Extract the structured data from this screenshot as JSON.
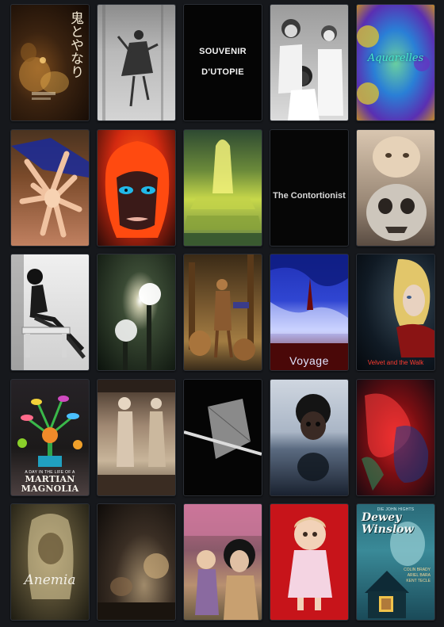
{
  "posters": [
    {
      "id": "oni",
      "title": "鬼とやなり"
    },
    {
      "id": "bw-dancer",
      "title": ""
    },
    {
      "id": "souvenir",
      "title_line1": "SOUVENIR",
      "title_line2": "D'UTOPIE"
    },
    {
      "id": "girls",
      "title": ""
    },
    {
      "id": "aquarelles",
      "title": "Aquarelles"
    },
    {
      "id": "dolls-limbs",
      "title": ""
    },
    {
      "id": "redhair",
      "title": ""
    },
    {
      "id": "fountain",
      "title": ""
    },
    {
      "id": "contortionist",
      "title": "The Contortionist"
    },
    {
      "id": "doll-mask",
      "title": ""
    },
    {
      "id": "pinup",
      "title": ""
    },
    {
      "id": "lamps",
      "title": ""
    },
    {
      "id": "native",
      "title": ""
    },
    {
      "id": "voyage",
      "title": "Voyage"
    },
    {
      "id": "velvet",
      "title": "Velvet and the Walk"
    },
    {
      "id": "martian",
      "kicker": "A DAY IN THE LIFE OF A",
      "title_line1": "MARTIAN",
      "title_line2": "MAGNOLIA"
    },
    {
      "id": "statues",
      "title": ""
    },
    {
      "id": "kite",
      "title": ""
    },
    {
      "id": "doll-water",
      "title": ""
    },
    {
      "id": "red-abstract",
      "title": ""
    },
    {
      "id": "anemia",
      "title": "Anemia"
    },
    {
      "id": "dark-scene",
      "title": ""
    },
    {
      "id": "children-dolls",
      "title": ""
    },
    {
      "id": "red-doll",
      "title": ""
    },
    {
      "id": "dewey",
      "credit": "DIE JOHN HIGHTS",
      "title_line1": "Dewey",
      "title_line2": "Winslow",
      "cast": [
        "COLIN BRADY",
        "ARIEL BARA",
        "KENT TECLE"
      ]
    }
  ],
  "colors": {
    "page_background": "#16181c",
    "tile_border": "#2b2f36"
  }
}
